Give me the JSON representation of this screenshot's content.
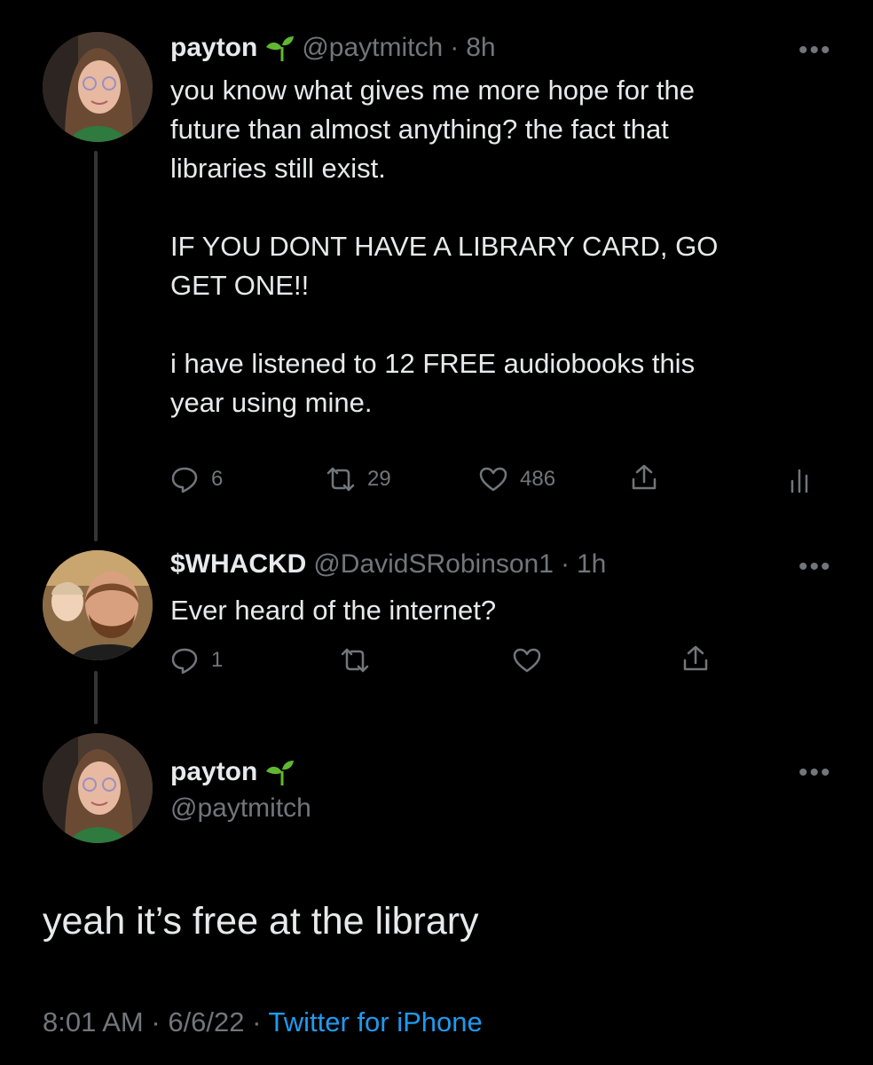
{
  "tweet1": {
    "name": "payton",
    "handle": "@paytmitch",
    "time": "8h",
    "text": "you know what gives me more hope for the\nfuture than almost anything? the fact that\nlibraries still exist.\n\nIF YOU DONT HAVE A LIBRARY CARD, GO\nGET ONE!!\n\ni have listened to 12 FREE audiobooks this\nyear using mine.",
    "replies": "6",
    "retweets": "29",
    "likes": "486"
  },
  "tweet2": {
    "name": "$WHACKD",
    "handle": "@DavidSRobinson1",
    "time": "1h",
    "text": "Ever heard of the internet?",
    "replies": "1"
  },
  "main_tweet": {
    "name": "payton",
    "handle": "@paytmitch",
    "text": "yeah it’s free at the library",
    "time": "8:01 AM",
    "date": "6/6/22",
    "source": "Twitter for iPhone"
  },
  "separator": "·",
  "more_glyph": "•••",
  "icons": {
    "reply": "reply-icon",
    "retweet": "retweet-icon",
    "like": "heart-icon",
    "share": "share-icon",
    "analytics": "analytics-icon",
    "verified_emoji": "seedling-icon"
  },
  "colors": {
    "background": "#000000",
    "text": "#e7e9ea",
    "muted": "#71767b",
    "link": "#1d9bf0",
    "sprout": "#5fb832"
  }
}
